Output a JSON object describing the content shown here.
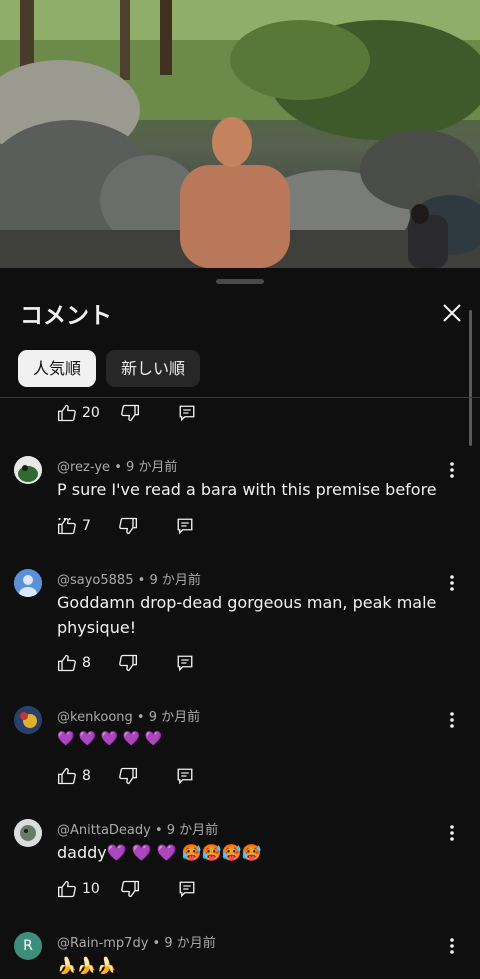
{
  "panel": {
    "title": "コメント"
  },
  "sort_chips": [
    {
      "label": "人気順"
    },
    {
      "label": "新しい順"
    }
  ],
  "top_partial": {
    "likes": "20"
  },
  "comments": [
    {
      "author": "@rez-ye",
      "time": "9 か月前",
      "text": "P sure I've read a bara with this premise before ...",
      "likes": "7",
      "avatar_color": "#3a7a3a"
    },
    {
      "author": "@sayo5885",
      "time": "9 か月前",
      "text": "Goddamn drop-dead gorgeous man, peak male physique!",
      "likes": "8",
      "avatar_color": "#5b8fd6"
    },
    {
      "author": "@kenkoong",
      "time": "9 か月前",
      "text": "💜 💜 💜 💜 💜",
      "likes": "8",
      "avatar_color": "#2a3f6b"
    },
    {
      "author": "@AnittaDeady",
      "time": "9 か月前",
      "text": "daddy💜 💜 💜 🥵🥵🥵🥵",
      "likes": "10",
      "avatar_color": "#7a8a7a"
    },
    {
      "author": "@Rain-mp7dy",
      "time": "9 か月前",
      "text": "🍌🍌🍌",
      "likes": "",
      "avatar_color": "#3d8f7c",
      "avatar_letter": "R"
    }
  ],
  "meta_separator": "•"
}
